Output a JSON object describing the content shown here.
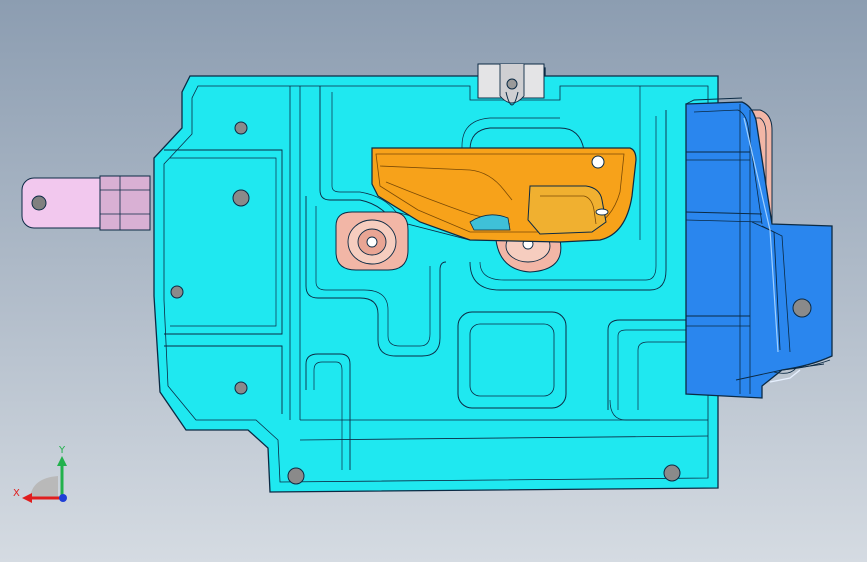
{
  "viewport": {
    "background_top": "#8c9db1",
    "background_bottom": "#d5dbe2"
  },
  "model": {
    "colors": {
      "base_plate": "#1fe8f0",
      "edge_line": "#0b2a44",
      "orange_bracket": "#f7a21a",
      "blue_bracket": "#2a86ee",
      "pink_boss": "#f2b6a6",
      "lilac_tab": "#f2c8ee",
      "grey_clip": "#d9d9dc"
    }
  },
  "triad": {
    "x_label": "X",
    "y_label": "Y",
    "x_color": "#e01e1e",
    "y_color": "#22b14c",
    "z_color": "#1f3fd6"
  }
}
